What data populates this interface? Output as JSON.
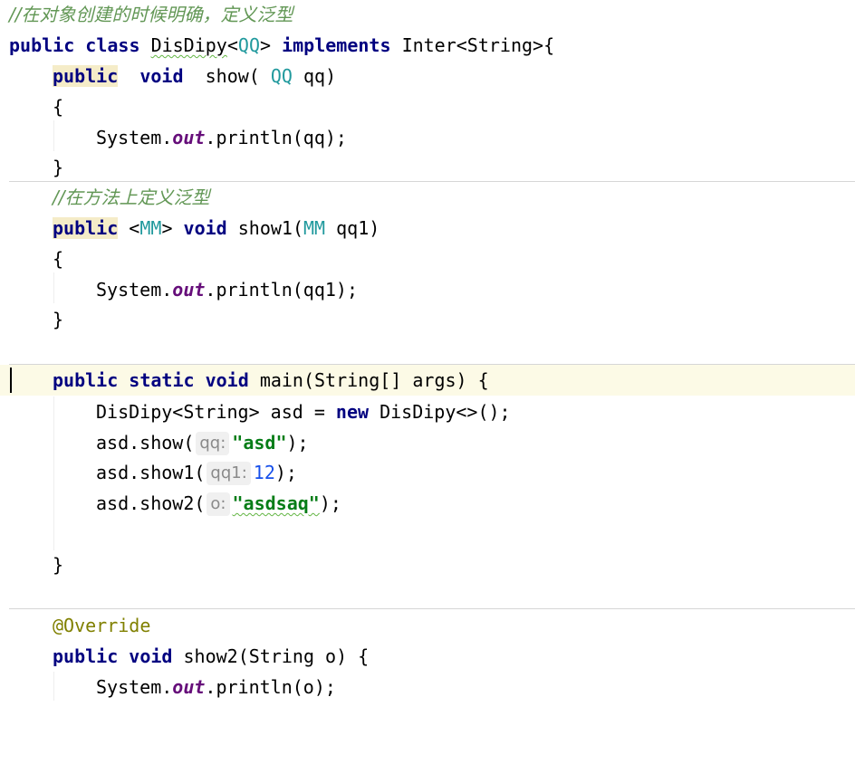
{
  "comment1": "//在对象创建的时候明确，定义泛型",
  "cls": {
    "public": "public",
    "class": "class",
    "name": "DisDipy",
    "lt": "<",
    "tparam": "QQ",
    "gt": ">",
    "implements": "implements",
    "iface": "Inter<String>{"
  },
  "show": {
    "public": "public",
    "void": "void",
    "name": "show(",
    "type": "QQ",
    "rest": "qq)"
  },
  "open_brace": "{",
  "close_brace": "}",
  "println1": {
    "sys": "System.",
    "out": "out",
    "rest": ".println(qq);"
  },
  "comment2": "//在方法上定义泛型",
  "show1": {
    "public": "public",
    "lt": "<",
    "tparam": "MM",
    "gt": ">",
    "void": "void",
    "name": "show1(",
    "type": "MM",
    "rest": "qq1)"
  },
  "println2": {
    "sys": "System.",
    "out": "out",
    "rest": ".println(qq1);"
  },
  "main": {
    "public": "public",
    "static": "static",
    "void": "void",
    "rest": "main(String[] args) {"
  },
  "decl": {
    "pre": "DisDipy<String> asd = ",
    "new": "new",
    "post": " DisDipy<>();"
  },
  "call1": {
    "pre": "asd.show(",
    "hint": "qq:",
    "str": "\"asd\"",
    "post": ");"
  },
  "call2": {
    "pre": "asd.show1(",
    "hint": "qq1:",
    "num": "12",
    "post": ");"
  },
  "call3": {
    "pre": "asd.show2(",
    "hint": "o:",
    "str": "\"asdsaq\"",
    "post": ");"
  },
  "override": "@Override",
  "show2": {
    "public": "public",
    "void": "void",
    "rest": "show2(String o) {"
  },
  "println3": {
    "sys": "System.",
    "out": "out",
    "rest": ".println(o);"
  }
}
